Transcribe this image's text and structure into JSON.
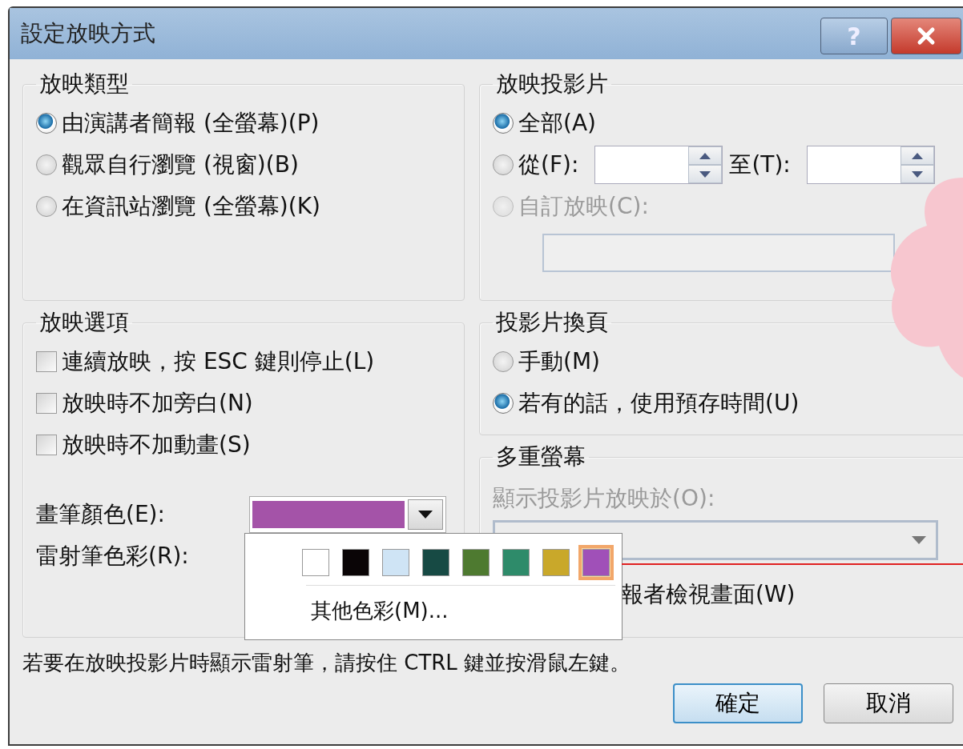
{
  "window": {
    "title": "設定放映方式"
  },
  "title_buttons": [
    {
      "kind": "help",
      "label": "?"
    },
    {
      "kind": "close"
    }
  ],
  "show_type": {
    "legend": "放映類型",
    "options": [
      {
        "label": "由演講者簡報 (全螢幕)(P)",
        "selected": true
      },
      {
        "label": "觀眾自行瀏覽 (視窗)(B)",
        "selected": false
      },
      {
        "label": "在資訊站瀏覽 (全螢幕)(K)",
        "selected": false
      }
    ]
  },
  "show_options": {
    "legend": "放映選項",
    "checkboxes": [
      {
        "label": "連續放映，按 ESC 鍵則停止(L)",
        "checked": false
      },
      {
        "label": "放映時不加旁白(N)",
        "checked": false
      },
      {
        "label": "放映時不加動畫(S)",
        "checked": false
      }
    ],
    "pen_color": {
      "label": "畫筆顏色(E):",
      "color": "#a453a8"
    },
    "laser_color": {
      "label": "雷射筆色彩(R):"
    }
  },
  "show_slides": {
    "legend": "放映投影片",
    "options": [
      {
        "kind": "all",
        "label": "全部(A)",
        "selected": true,
        "disabled": false
      },
      {
        "kind": "range",
        "label": "從(F):",
        "to_label": "至(T):",
        "selected": false,
        "disabled": false
      },
      {
        "kind": "custom",
        "label": "自訂放映(C):",
        "selected": false,
        "disabled": true
      }
    ]
  },
  "advance": {
    "legend": "投影片換頁",
    "options": [
      {
        "label": "手動(M)",
        "selected": false
      },
      {
        "label": "若有的話，使用預存時間(U)",
        "selected": true
      }
    ]
  },
  "monitors": {
    "legend": "多重螢幕",
    "label": "顯示投影片放映於(O):",
    "disabled": true,
    "presenter_view_label": "報者檢視畫面(W)"
  },
  "color_menu": {
    "swatches": [
      {
        "color": "#ffffff",
        "selected": false
      },
      {
        "color": "#0a0506",
        "selected": false
      },
      {
        "color": "#cfe4f5",
        "selected": false
      },
      {
        "color": "#174a44",
        "selected": false
      },
      {
        "color": "#4e7a30",
        "selected": false
      },
      {
        "color": "#2e8b6a",
        "selected": false
      },
      {
        "color": "#c9a82a",
        "selected": false
      },
      {
        "color": "#a050b8",
        "selected": true
      }
    ],
    "more": "其他色彩(M)..."
  },
  "hint": "若要在放映投影片時顯示雷射筆，請按住 CTRL 鍵並按滑鼠左鍵。",
  "buttons": [
    {
      "label": "確定",
      "default": true
    },
    {
      "label": "取消",
      "default": false
    }
  ]
}
